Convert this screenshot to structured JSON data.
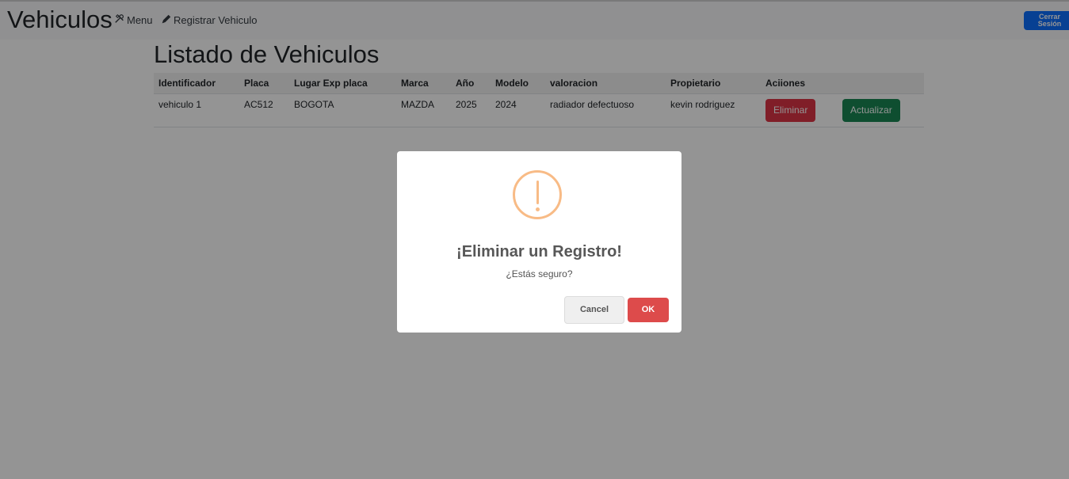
{
  "navbar": {
    "brand": "Vehiculos",
    "menu_label": "Menu",
    "menu_icon": "tools-icon",
    "register_label": "Registrar Vehiculo",
    "register_icon": "pencil-icon",
    "logout_line1": "Cerrar",
    "logout_line2": "Sesión"
  },
  "main": {
    "title": "Listado de Vehiculos",
    "table": {
      "headers": [
        "Identificador",
        "Placa",
        "Lugar Exp placa",
        "Marca",
        "Año",
        "Modelo",
        "valoracion",
        "Propietario",
        "Aciiones",
        ""
      ],
      "rows": [
        {
          "identificador": "vehiculo 1",
          "placa": "AC512",
          "lugar": "BOGOTA",
          "marca": "MAZDA",
          "anio": "2025",
          "modelo": "2024",
          "valoracion": "radiador defectuoso",
          "propietario": "kevin rodriguez",
          "delete_label": "Eliminar",
          "update_label": "Actualizar"
        }
      ]
    }
  },
  "dialog": {
    "icon": "warning-icon",
    "title": "¡Eliminar un Registro!",
    "text": "¿Estás seguro?",
    "cancel_label": "Cancel",
    "ok_label": "OK"
  },
  "colors": {
    "primary": "#0d6efd",
    "danger": "#dc3545",
    "success": "#198754",
    "warning_icon": "#f8bb86",
    "confirm": "#dd4b4b"
  }
}
